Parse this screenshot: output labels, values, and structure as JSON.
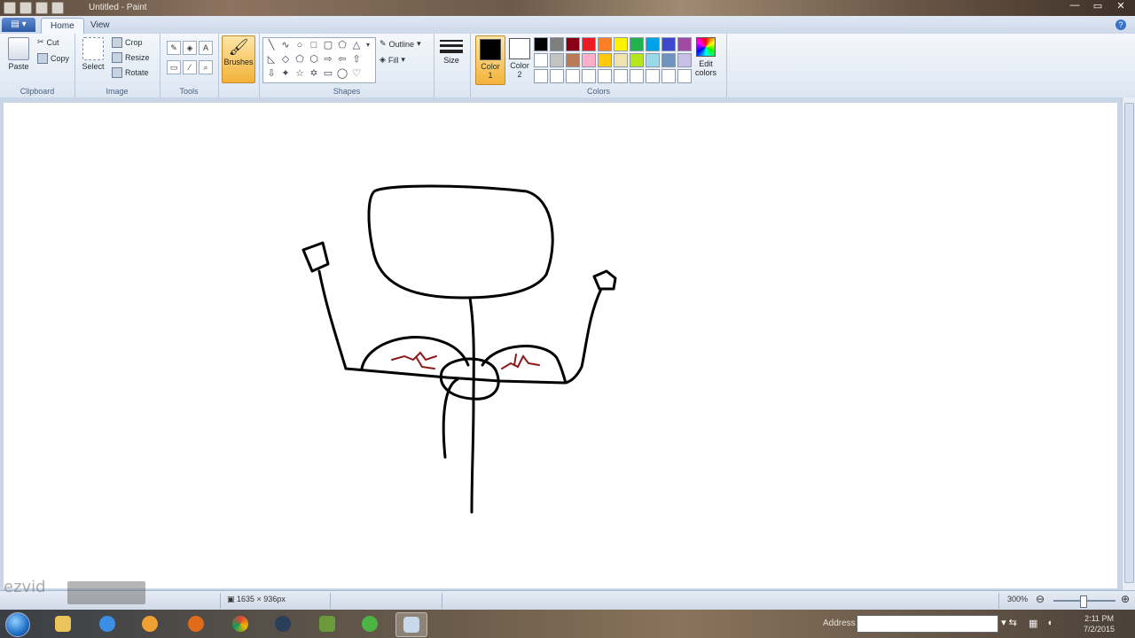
{
  "window": {
    "title": "Untitled - Paint",
    "controls": [
      "—",
      "▭",
      "✕"
    ]
  },
  "tabs": {
    "file": "",
    "home": "Home",
    "view": "View"
  },
  "ribbon": {
    "clipboard": {
      "label": "Clipboard",
      "paste": "Paste",
      "cut": "Cut",
      "copy": "Copy"
    },
    "image": {
      "label": "Image",
      "select": "Select",
      "crop": "Crop",
      "resize": "Resize",
      "rotate": "Rotate"
    },
    "tools": {
      "label": "Tools"
    },
    "brushes": {
      "label": "Brushes"
    },
    "shapes": {
      "label": "Shapes",
      "outline": "Outline",
      "fill": "Fill"
    },
    "size": {
      "label": "Size"
    },
    "colors": {
      "label": "Colors",
      "color1_label": "Color",
      "color1_num": "1",
      "color2_label": "Color",
      "color2_num": "2",
      "color1_value": "#000000",
      "color2_value": "#ffffff",
      "edit_colors": "Edit colors",
      "palette_row1": [
        "#000000",
        "#7f7f7f",
        "#880015",
        "#ed1c24",
        "#ff7f27",
        "#fff200",
        "#22b14c",
        "#00a2e8",
        "#3f48cc",
        "#a349a4"
      ],
      "palette_row2": [
        "#ffffff",
        "#c3c3c3",
        "#b97a57",
        "#ffaec9",
        "#ffc90e",
        "#efe4b0",
        "#b5e61d",
        "#99d9ea",
        "#7092be",
        "#c8bfe7"
      ],
      "palette_row3": [
        "#ffffff",
        "#ffffff",
        "#ffffff",
        "#ffffff",
        "#ffffff",
        "#ffffff",
        "#ffffff",
        "#ffffff",
        "#ffffff",
        "#ffffff"
      ]
    }
  },
  "drawing": {
    "stroke_color": "#000000",
    "accent_color": "#8b1a1a"
  },
  "statusbar": {
    "canvas_size": "1635 × 936px",
    "zoom": "300%"
  },
  "watermark": {
    "text": "ezvid"
  },
  "taskbar": {
    "address_label": "Address",
    "time": "2:11 PM",
    "date": "7/2/2015"
  }
}
